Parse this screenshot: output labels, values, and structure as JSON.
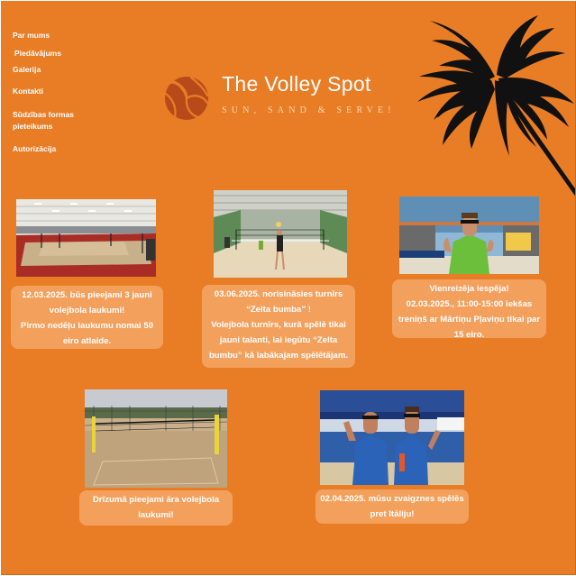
{
  "nav": {
    "items": [
      {
        "label": "Par mums"
      },
      {
        "label": "Piedāvājums"
      },
      {
        "label": "Galerija"
      },
      {
        "label": "Kontakti"
      },
      {
        "label": "Sūdzības formas pieteikums"
      },
      {
        "label": "Autorizācija"
      }
    ]
  },
  "brand": {
    "title": "The Volley Spot",
    "tagline": "SUN, SAND & SERVE!",
    "logo_icon": "volleyball-icon",
    "decor_icon": "palm-tree-icon"
  },
  "colors": {
    "background": "#e87d26",
    "card": "#f3a05c",
    "text": "#ffffff",
    "logo": "#b84a1a",
    "palm": "#111111"
  },
  "news": [
    {
      "image": "indoor-courts-photo",
      "lines": [
        "12.03.2025. būs pieejami 3 jauni volejbola laukumi!",
        "Pirmo nedēļu laukumu nomai 50 eiro atlaide."
      ]
    },
    {
      "image": "sand-hall-game-photo",
      "lines": [
        "03.06.2025. norisināsies turnīrs “Zelta bumba” !",
        "Volejbola turnīrs, kurā spēlē tikai jauni talanti, lai iegūtu “Zelta bumbu” kā labākajam spēlētājam."
      ]
    },
    {
      "image": "player-portrait-photo",
      "lines": [
        "Vienreizēja iespēja!",
        "02.03.2025., 11:00-15:00 iekšas treniņš ar Mārtiņu Pļaviņu tikai par 15 eiro."
      ]
    },
    {
      "image": "outdoor-courts-photo",
      "lines": [
        "Drīzumā pieejami āra volejbola laukumi!"
      ]
    },
    {
      "image": "team-photo",
      "lines": [
        "02.04.2025. mūsu zvaigznes spēlēs pret Itāliju!"
      ]
    }
  ]
}
